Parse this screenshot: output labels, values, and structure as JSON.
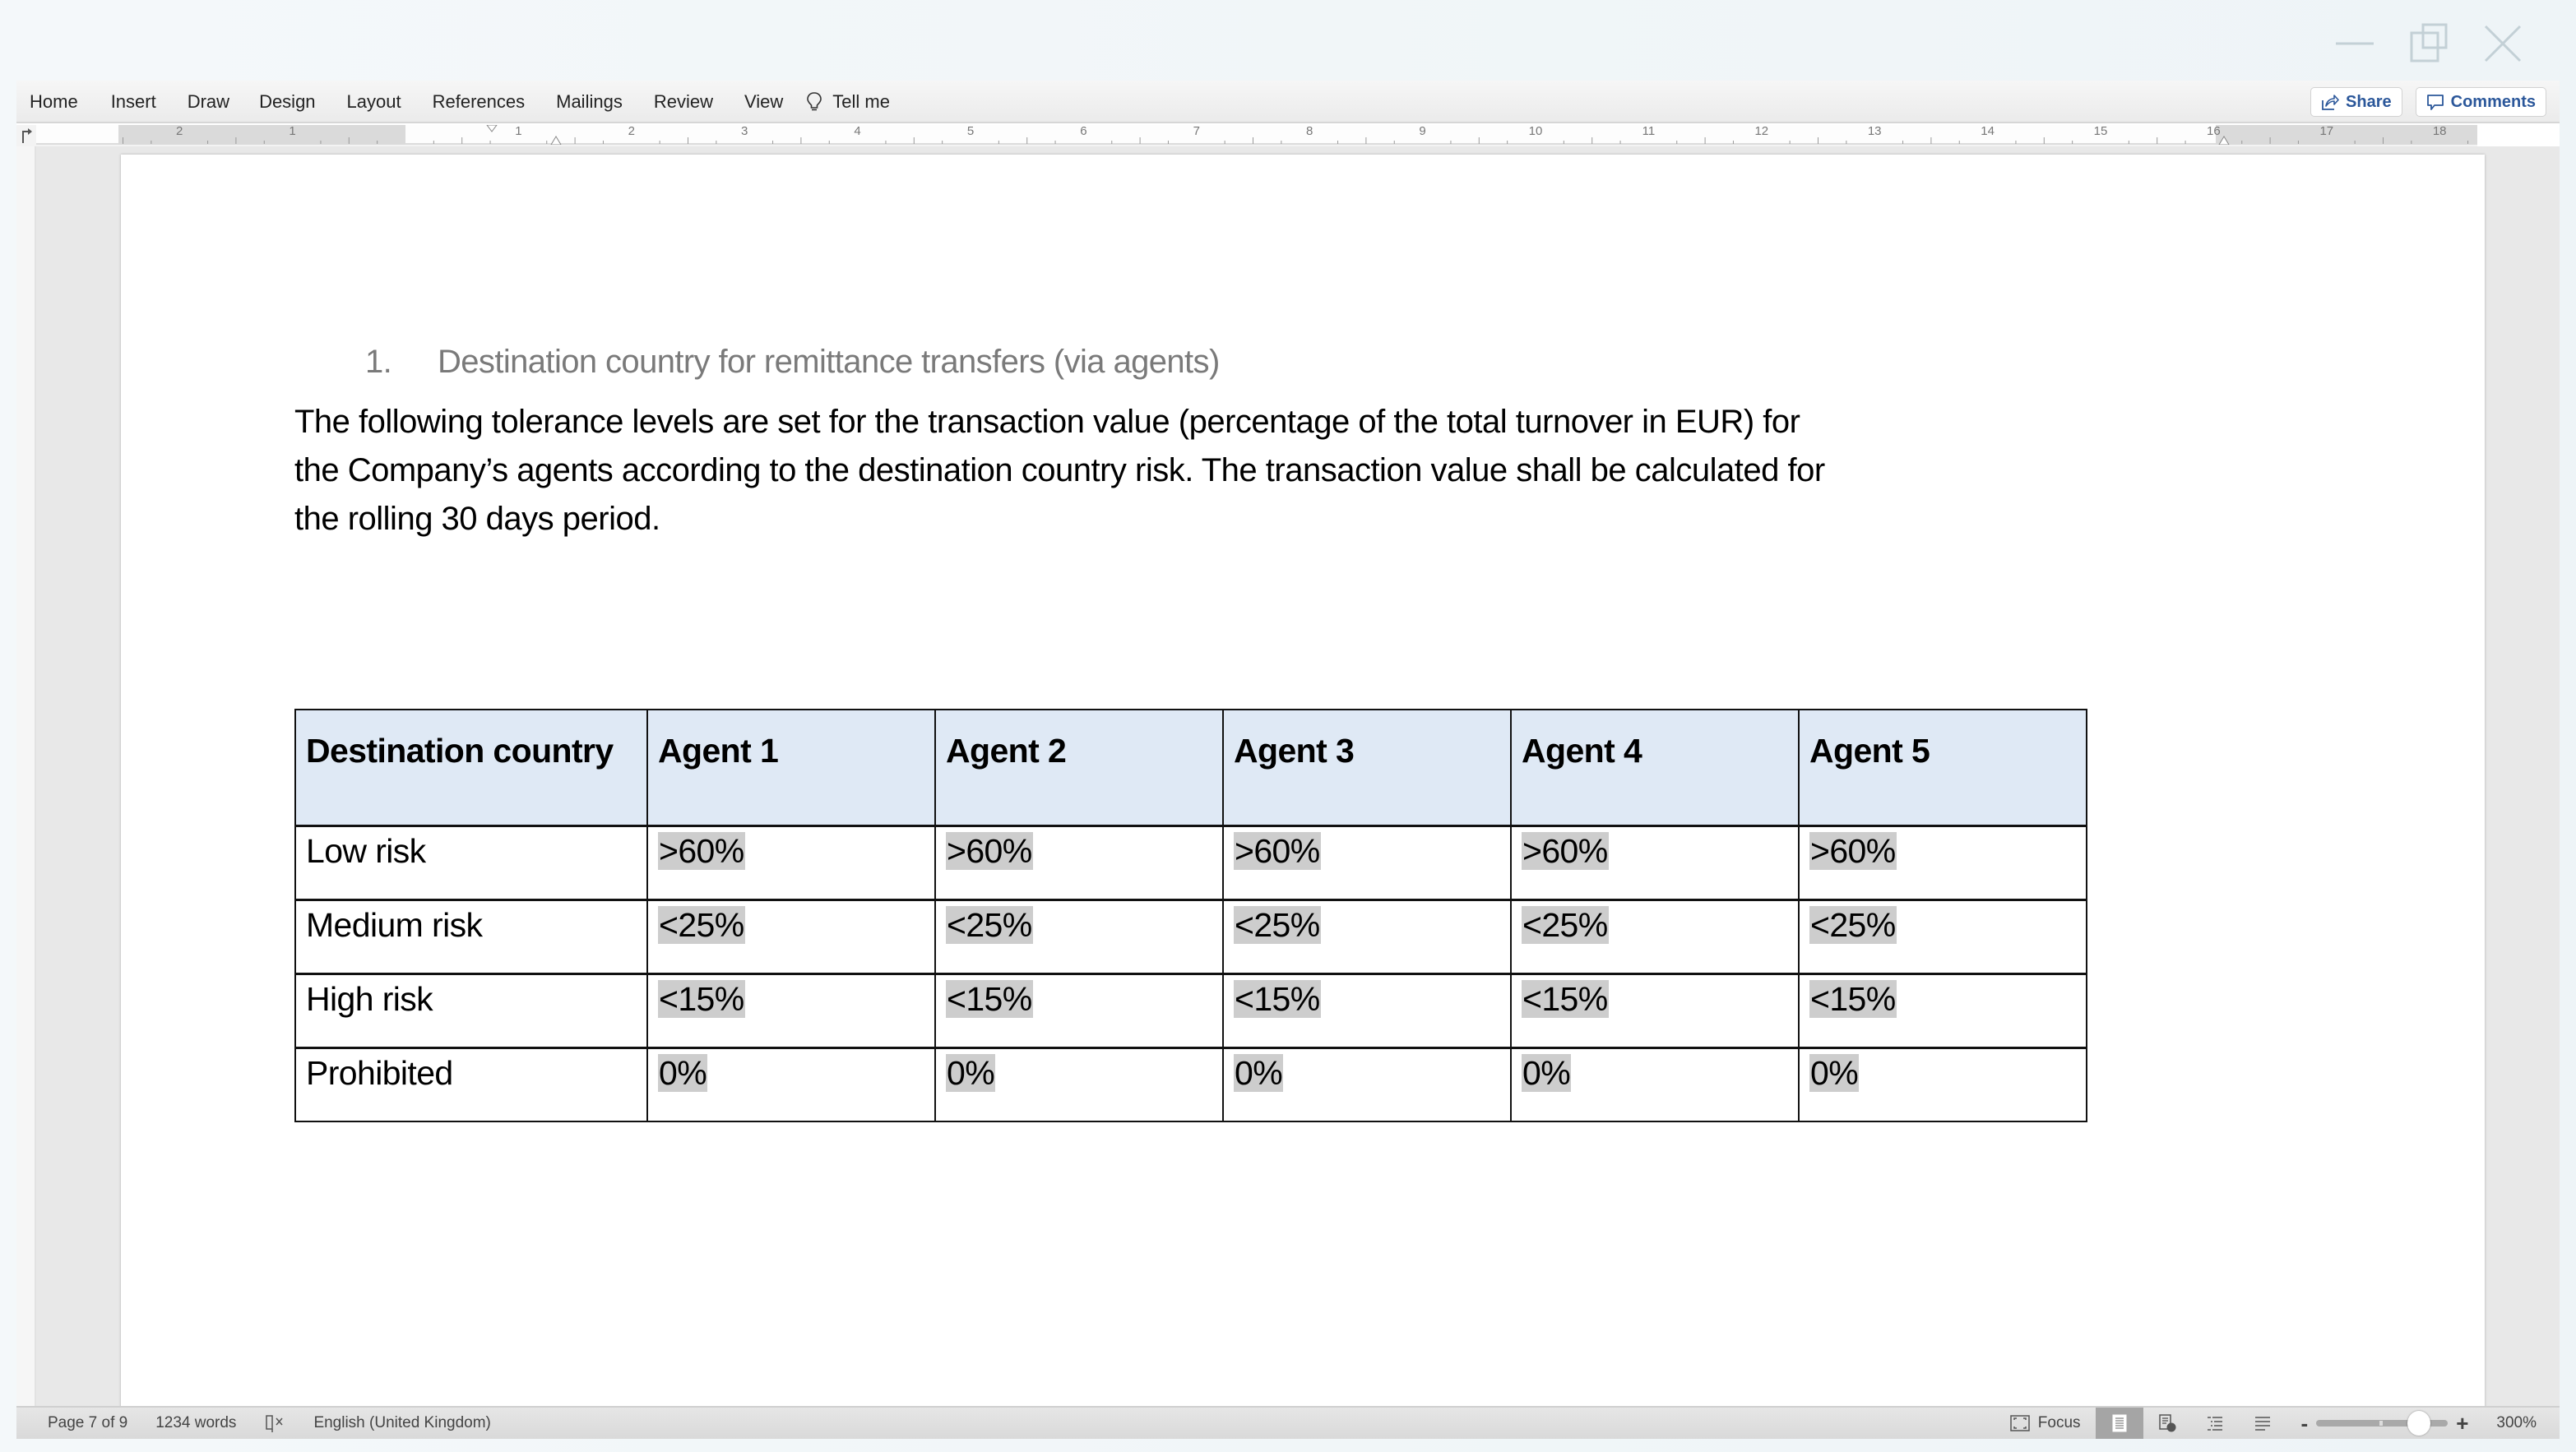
{
  "window": {
    "controls": [
      "minimize",
      "restore",
      "close"
    ]
  },
  "ribbon": {
    "tabs": [
      {
        "label": "Home"
      },
      {
        "label": "Insert"
      },
      {
        "label": "Draw"
      },
      {
        "label": "Design"
      },
      {
        "label": "Layout"
      },
      {
        "label": "References"
      },
      {
        "label": "Mailings"
      },
      {
        "label": "Review"
      },
      {
        "label": "View"
      }
    ],
    "tell_me": {
      "label": "Tell me",
      "icon": "lightbulb-icon"
    },
    "share": {
      "label": "Share",
      "icon": "share-icon"
    },
    "comments": {
      "label": "Comments",
      "icon": "comment-icon"
    }
  },
  "ruler": {
    "left_margin_labels": [
      "2",
      "1"
    ],
    "labels": [
      "1",
      "2",
      "3",
      "4",
      "5",
      "6",
      "7",
      "8",
      "9",
      "10",
      "11",
      "12",
      "13",
      "14",
      "15",
      "16",
      "17",
      "18"
    ],
    "unit": "cm"
  },
  "document": {
    "heading": {
      "number": "1.",
      "text": "Destination country for remittance transfers (via agents)"
    },
    "paragraph": {
      "lines": [
        "The following tolerance levels are set for the transaction value (percentage of the total turnover in EUR) for",
        "the Company’s agents according to the destination country risk. The transaction value shall be calculated for",
        "the rolling 30 days period."
      ]
    },
    "table": {
      "header_fill": "#dfe9f5",
      "highlight_fill": "#cdcdcd",
      "columns": [
        "Destination country",
        "Agent 1",
        "Agent 2",
        "Agent 3",
        "Agent 4",
        "Agent 5"
      ],
      "rows": [
        {
          "label": "Low risk",
          "values": [
            ">60%",
            ">60%",
            ">60%",
            ">60%",
            ">60%"
          ]
        },
        {
          "label": "Medium risk",
          "values": [
            "<25%",
            "<25%",
            "<25%",
            "<25%",
            "<25%"
          ]
        },
        {
          "label": "High risk",
          "values": [
            "<15%",
            "<15%",
            "<15%",
            "<15%",
            "<15%"
          ]
        },
        {
          "label": "Prohibited",
          "values": [
            "0%",
            "0%",
            "0%",
            "0%",
            "0%"
          ]
        }
      ]
    }
  },
  "status_bar": {
    "page": "Page 7 of 9",
    "words": "1234 words",
    "proofing_icon": "proofing-book-icon",
    "language": "English (United Kingdom)",
    "focus": "Focus",
    "views": [
      "print-layout",
      "web-layout",
      "outline",
      "draft"
    ],
    "active_view": "print-layout",
    "zoom_minus": "-",
    "zoom_plus": "+",
    "zoom_level": "300%",
    "zoom_slider_fraction": 0.78
  }
}
